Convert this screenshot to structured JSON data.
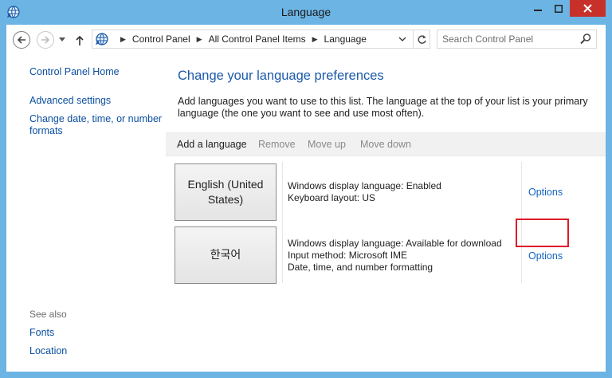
{
  "window": {
    "title": "Language"
  },
  "nav": {
    "breadcrumb": [
      "Control Panel",
      "All Control Panel Items",
      "Language"
    ],
    "search_placeholder": "Search Control Panel"
  },
  "sidebar": {
    "items": [
      {
        "label": "Control Panel Home"
      },
      {
        "label": "Advanced settings"
      },
      {
        "label": "Change date, time, or number formats"
      }
    ],
    "see_also_label": "See also",
    "see_also": [
      {
        "label": "Fonts"
      },
      {
        "label": "Location"
      }
    ]
  },
  "main": {
    "title": "Change your language preferences",
    "description": "Add languages you want to use to this list. The language at the top of your list is your primary language (the one you want to see and use most often).",
    "toolbar": {
      "add": "Add a language",
      "remove": "Remove",
      "move_up": "Move up",
      "move_down": "Move down"
    },
    "languages": [
      {
        "name": "English (United States)",
        "info": [
          "Windows display language: Enabled",
          "Keyboard layout: US"
        ],
        "options": "Options"
      },
      {
        "name": "한국어",
        "info": [
          "Windows display language: Available for download",
          "Input method: Microsoft IME",
          "Date, time, and number formatting"
        ],
        "options": "Options"
      }
    ]
  },
  "colors": {
    "frame": "#6cb4e4",
    "close_button": "#c7312a",
    "link": "#0b4fa0",
    "title": "#1c5aa8",
    "highlight": "#e01a2a"
  },
  "icons": {
    "app": "language-globe-icon",
    "back": "back-arrow-icon",
    "forward": "forward-arrow-icon",
    "up": "up-arrow-icon",
    "refresh": "refresh-icon",
    "search": "search-icon"
  }
}
